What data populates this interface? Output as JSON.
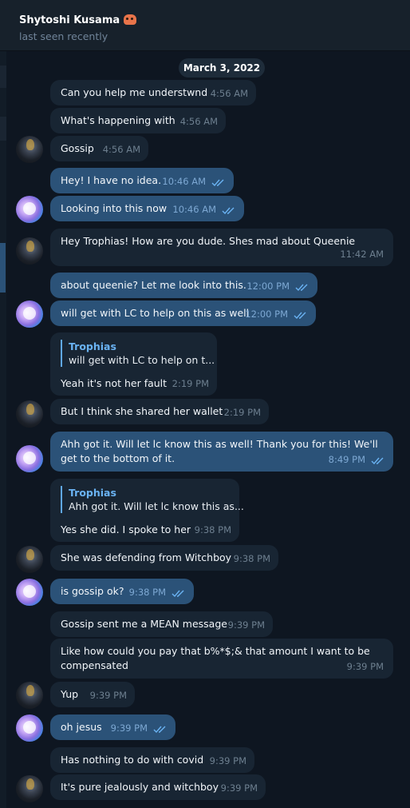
{
  "header": {
    "contact_name": "Shytoshi Kusama",
    "contact_emoji": "cat-face-emoji",
    "status": "last seen recently"
  },
  "date_divider": "March 3, 2022",
  "colors": {
    "background": "#0e1621",
    "incoming_bubble": "#182533",
    "outgoing_bubble": "#2b5278",
    "reply_accent": "#6ab3f3"
  },
  "messages": [
    {
      "dir": "in",
      "text": "Can you help me understwnd",
      "time": "4:56 AM"
    },
    {
      "dir": "in",
      "text": "What's happening with",
      "time": "4:56 AM"
    },
    {
      "dir": "in",
      "text": "Gossip",
      "time": "4:56 AM"
    },
    {
      "dir": "out",
      "text": "Hey! I have no idea.",
      "time": "10:46 AM",
      "read": true
    },
    {
      "dir": "out",
      "text": "Looking into this now",
      "time": "10:46 AM",
      "read": true
    },
    {
      "dir": "in",
      "text": "Hey Trophias! How are you dude. Shes mad about Queenie",
      "time": "11:42 AM"
    },
    {
      "dir": "out",
      "text": "about queenie? Let me look into this.",
      "time": "12:00 PM",
      "read": true
    },
    {
      "dir": "out",
      "text": "will get with LC to help on this as well",
      "time": "12:00 PM",
      "read": true
    },
    {
      "dir": "in",
      "text": "Yeah it's not her fault",
      "time": "2:19 PM",
      "reply_to": {
        "name": "Trophias",
        "text": "will get with LC to help on t..."
      }
    },
    {
      "dir": "in",
      "text": "But I think she shared her wallet",
      "time": "2:19 PM"
    },
    {
      "dir": "out",
      "text": "Ahh got it. Will let lc know this as well! Thank you for this! We'll get to the bottom of it.",
      "time": "8:49 PM",
      "read": true
    },
    {
      "dir": "in",
      "text": "Yes she did. I spoke to her",
      "time": "9:38 PM",
      "reply_to": {
        "name": "Trophias",
        "text": "Ahh got it. Will let lc know this as..."
      }
    },
    {
      "dir": "in",
      "text": "She was defending from Witchboy",
      "time": "9:38 PM"
    },
    {
      "dir": "out",
      "text": "is gossip ok?",
      "time": "9:38 PM",
      "read": true
    },
    {
      "dir": "in",
      "text": "Gossip sent me a MEAN message",
      "time": "9:39 PM"
    },
    {
      "dir": "in",
      "text": "Like how could you pay that b%*$;& that amount I want to be compensated",
      "time": "9:39 PM"
    },
    {
      "dir": "in",
      "text": "Yup",
      "time": "9:39 PM"
    },
    {
      "dir": "out",
      "text": "oh jesus",
      "time": "9:39 PM",
      "read": true
    },
    {
      "dir": "in",
      "text": "Has nothing to do with covid",
      "time": "9:39 PM"
    },
    {
      "dir": "in",
      "text": "It's pure jealously and witchboy",
      "time": "9:39 PM"
    }
  ]
}
